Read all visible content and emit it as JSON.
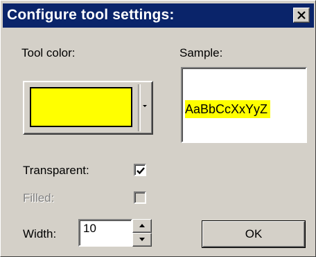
{
  "window": {
    "title": "Configure tool settings:",
    "close_icon": "close-icon"
  },
  "labels": {
    "tool_color": "Tool color:",
    "sample": "Sample:",
    "transparent": "Transparent:",
    "filled": "Filled:",
    "width": "Width:"
  },
  "tool_color": {
    "value": "#ffff00",
    "dropdown_icon": "chevron-down-icon"
  },
  "sample": {
    "text": "AaBbCcXxYyZ",
    "highlight_color": "#ffff00"
  },
  "options": {
    "transparent_checked": true,
    "filled_checked": false,
    "filled_enabled": false
  },
  "width": {
    "value": "10",
    "up_icon": "arrow-up-icon",
    "down_icon": "arrow-down-icon"
  },
  "buttons": {
    "ok": "OK"
  },
  "colors": {
    "title_bar": "#0a246a",
    "dialog_face": "#d4d0c8"
  }
}
